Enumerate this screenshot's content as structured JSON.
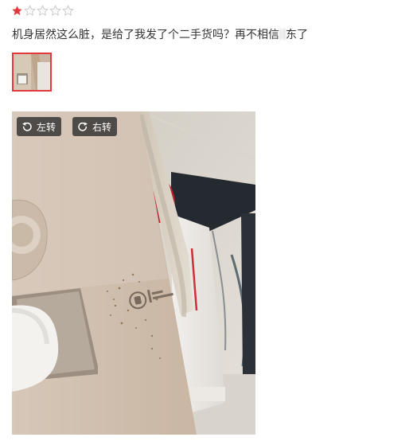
{
  "review": {
    "rating": 1,
    "rating_max": 5,
    "star_filled_color": "#e4393c",
    "star_empty_color": "#cccccc",
    "text_before": "机身居然这么脏，是给了我发了个二手货吗？再不相信",
    "text_after": "东了"
  },
  "thumbnail": {
    "selected": true,
    "border_color": "#e4393c"
  },
  "viewer": {
    "rotate_left_label": "左转",
    "rotate_right_label": "右转",
    "rotate_left_icon": "rotate-left-icon",
    "rotate_right_icon": "rotate-right-icon"
  }
}
